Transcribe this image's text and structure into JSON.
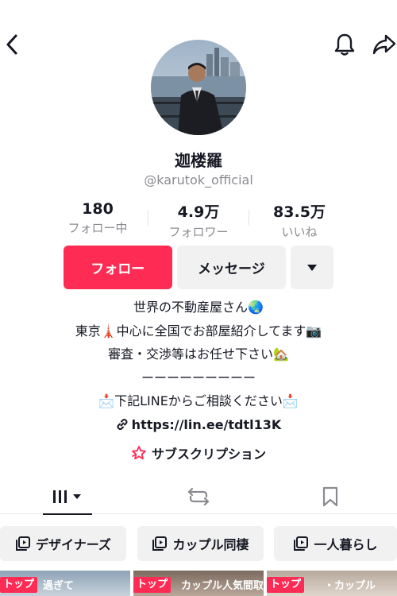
{
  "profile": {
    "display_name": "迦楼羅",
    "username": "@karutok_official"
  },
  "stats": [
    {
      "value": "180",
      "label": "フォロー中"
    },
    {
      "value": "4.9万",
      "label": "フォロワー"
    },
    {
      "value": "83.5万",
      "label": "いいね"
    }
  ],
  "actions": {
    "follow_label": "フォロー",
    "message_label": "メッセージ"
  },
  "bio": {
    "line1": "世界の不動産屋さん🌏",
    "line2": "東京🗼中心に全国でお部屋紹介してます📷",
    "line3": "審査・交渉等はお任せ下さい🏡",
    "line4": "ーーーーーーーーー",
    "line5": "📩下記LINEからご相談ください📩",
    "link": "https://lin.ee/tdtl13K"
  },
  "subscription_label": "サブスクリプション",
  "playlists": [
    "デザイナーズ",
    "カップル同棲",
    "一人暮らし"
  ],
  "thumbnails": [
    {
      "badge": "トップ",
      "text": "過ぎて"
    },
    {
      "badge": "トップ",
      "text": "カップル人気間取り"
    },
    {
      "badge": "トップ",
      "text": "・カップル"
    }
  ],
  "colors": {
    "accent": "#fe2c55",
    "text": "#161823",
    "secondary_text": "#8a8b91",
    "button_gray": "#f1f1f2"
  }
}
